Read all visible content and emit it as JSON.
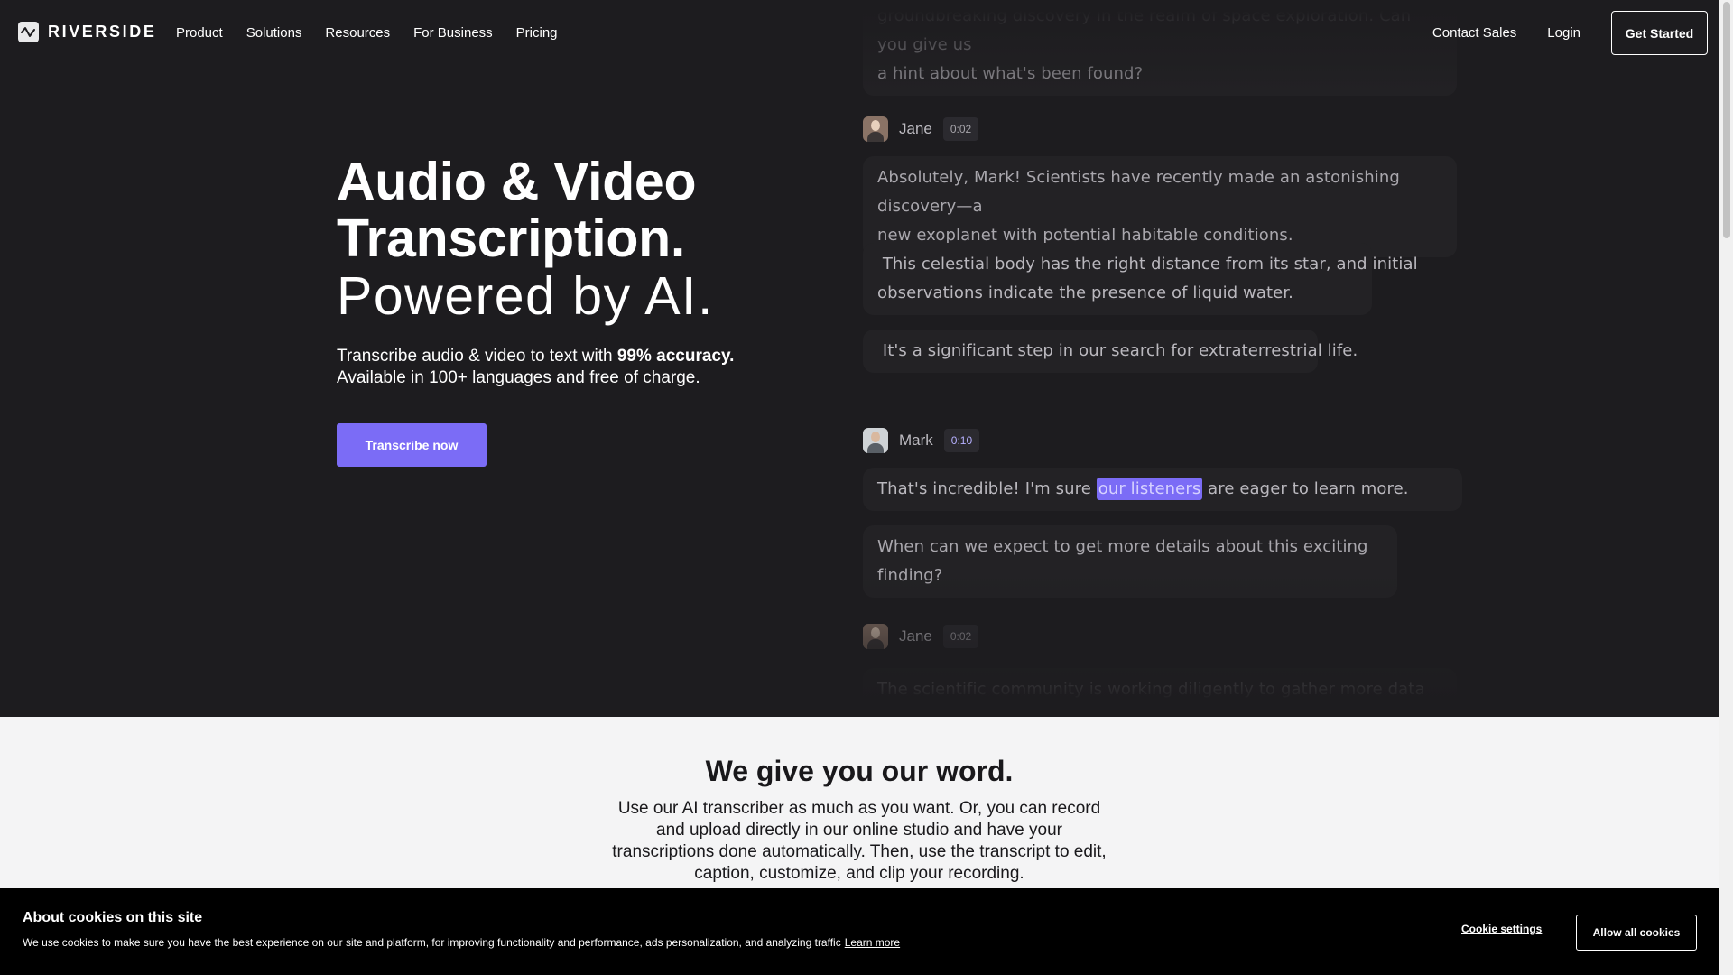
{
  "nav": {
    "logo_text": "RIVERSIDE",
    "links": [
      "Product",
      "Solutions",
      "Resources",
      "For Business",
      "Pricing"
    ],
    "contact_sales": "Contact Sales",
    "login": "Login",
    "get_started": "Get Started"
  },
  "hero": {
    "title_line1": "Audio & Video",
    "title_line2": "Transcription.",
    "title_line3": "Powered by AI.",
    "sub_line1_pre": "Transcribe audio & video to text with ",
    "sub_line1_bold": "99% accuracy.",
    "sub_line2": "Available in 100+ languages and free of charge.",
    "cta": "Transcribe now"
  },
  "transcript": {
    "top_partial_1": "groundbreaking discovery in the realm of space exploration. Can you give us",
    "top_partial_2": "a hint about what's been found?",
    "speaker1": {
      "name": "Jane",
      "time": "0:02"
    },
    "jane_line1a": "Absolutely, Mark! Scientists have recently made an astonishing discovery—a",
    "jane_line1b": "new exoplanet with potential habitable conditions.",
    "jane_line2a": " This celestial body has the right distance from its star, and initial",
    "jane_line2b": "observations indicate the presence of liquid water.",
    "jane_line3": " It's a significant step in our search for extraterrestrial life.",
    "speaker2": {
      "name": "Mark",
      "time": "0:10"
    },
    "mark_line1_pre": "That's incredible! I'm sure ",
    "mark_line1_hl": "our listeners",
    "mark_line1_post": " are eager to learn more.",
    "mark_line2": "When can we expect to get more details about this exciting finding?",
    "speaker3": {
      "name": "Jane",
      "time": "0:02"
    },
    "bottom_partial": "The scientific community is working diligently to gather more data and"
  },
  "section": {
    "title": "We give you our word.",
    "body": "Use our AI transcriber as much as you want. Or, you can record and upload directly in our online studio and have your transcriptions done automatically. Then, use the transcript to edit, caption, customize, and clip your recording."
  },
  "cookie": {
    "title": "About cookies on this site",
    "text": "We use cookies to make sure you have the best experience on our site and platform, for improving functionality and performance, ads personalization, and analyzing traffic",
    "learn_more": "Learn more",
    "settings": "Cookie settings",
    "allow": "Allow all cookies"
  },
  "colors": {
    "accent": "#7b6cf6",
    "dark_bg": "#1d1c1f",
    "light_bg": "#f4f4f5"
  }
}
